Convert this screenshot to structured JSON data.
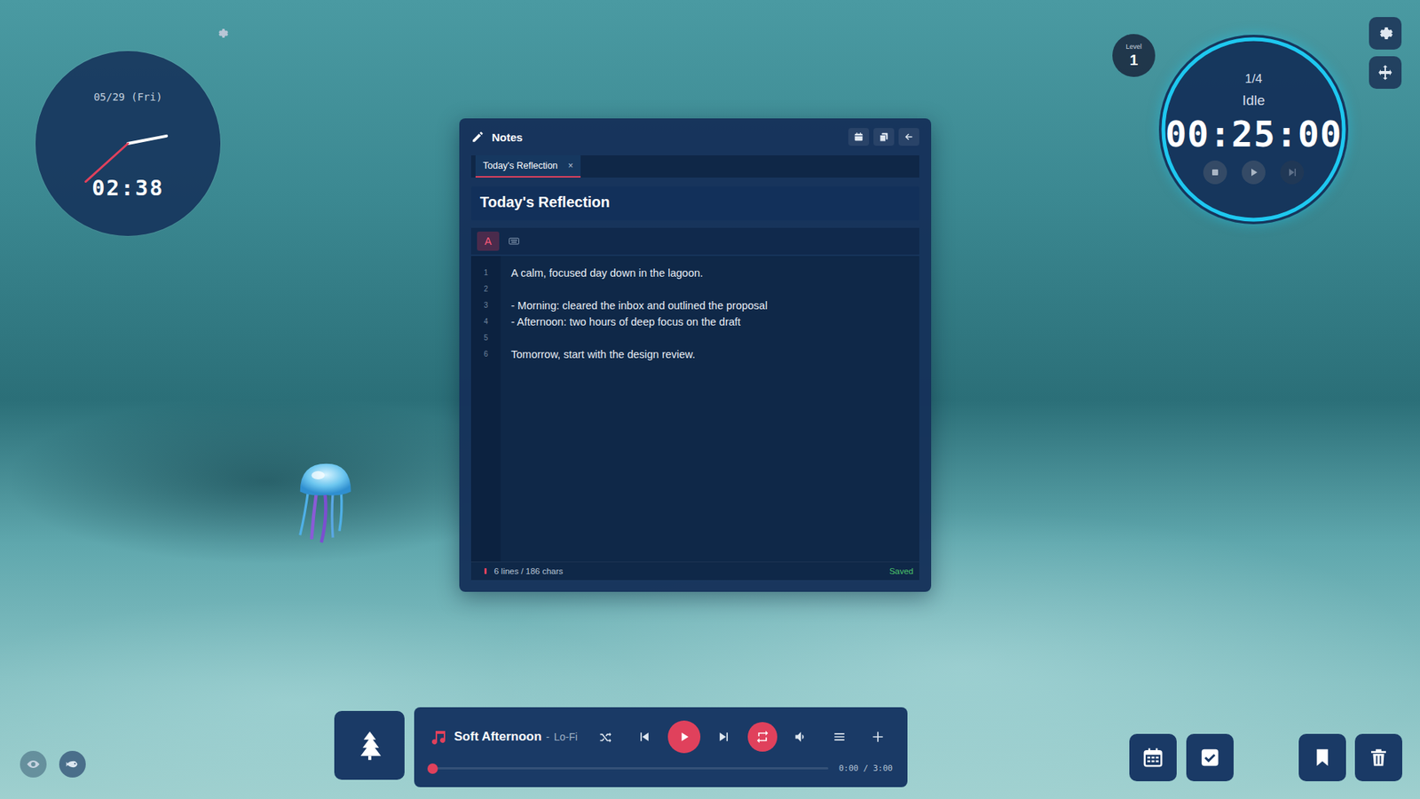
{
  "clock": {
    "date": "05/29 (Fri)",
    "time": "02:38"
  },
  "level_badge": {
    "label": "Level",
    "value": "1"
  },
  "timer": {
    "session": "1/4",
    "status": "Idle",
    "time": "00:25:00",
    "level": 1,
    "controls": [
      {
        "kind": "stop",
        "disabled": false
      },
      {
        "kind": "play",
        "disabled": false
      },
      {
        "kind": "skip",
        "disabled": true
      }
    ]
  },
  "notes": {
    "title": "Notes",
    "tabs": [
      {
        "label": "Today's Reflection",
        "close": "×",
        "selected": true
      }
    ],
    "doc_title": "Today's Reflection",
    "font_button": {
      "label": "A",
      "selected": true
    },
    "lines": [
      {
        "number": "1",
        "text": "A calm, focused day down in the lagoon."
      },
      {
        "number": "2",
        "text": ""
      },
      {
        "number": "3",
        "text": "- Morning: cleared the inbox and outlined the proposal"
      },
      {
        "number": "4",
        "text": "- Afternoon: two hours of deep focus on the draft"
      },
      {
        "number": "5",
        "text": ""
      },
      {
        "number": "6",
        "text": "Tomorrow, start with the design review."
      }
    ],
    "status": {
      "counts": "6 lines / 186 chars",
      "saved": "Saved"
    }
  },
  "player": {
    "track": "Soft Afternoon",
    "separator": "-",
    "genre": "Lo-Fi",
    "shuffle": false,
    "repeat": true,
    "playing": false,
    "progress": 0,
    "time": "0:00 / 3:00"
  }
}
